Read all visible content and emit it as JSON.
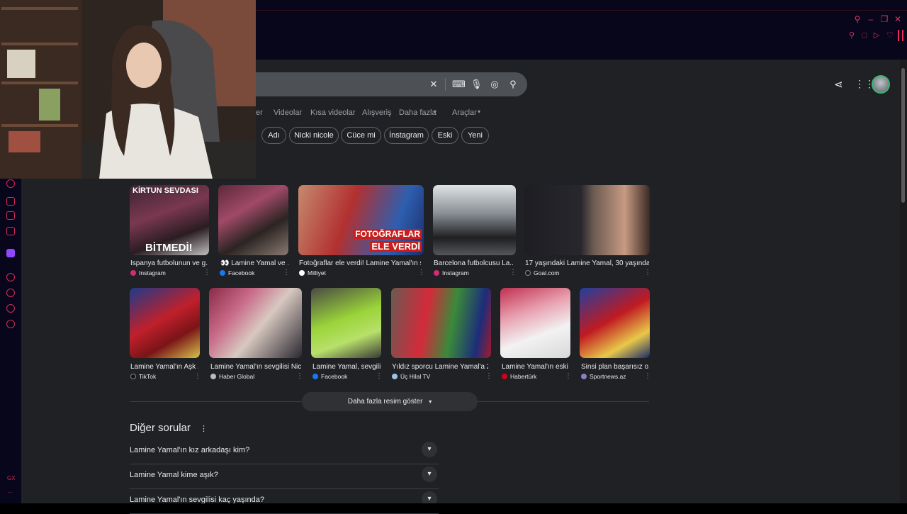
{
  "browser": {
    "sidebar_label": "GX",
    "sidebar_dots": "···"
  },
  "tabs": {
    "partial": "er",
    "items": [
      "Videolar",
      "Kısa videolar",
      "Alışveriş",
      "Daha fazla",
      "Araçlar"
    ]
  },
  "chips": [
    "Adı",
    "Nicki nicole",
    "Cüce mi",
    "İnstagram",
    "Eski",
    "Yeni"
  ],
  "images_row1": [
    {
      "caption": "İspanya futbolunun ve g...",
      "source": "Instagram",
      "source_color": "#d62976"
    },
    {
      "caption": "👀 Lamine Yamal ve ...",
      "source": "Facebook",
      "source_color": "#1877f2"
    },
    {
      "caption": "Fotoğraflar ele verdi! Lamine Yamal'ın s...",
      "source": "Milliyet",
      "source_color": "#ffffff"
    },
    {
      "caption": "Barcelona futbolcusu La...",
      "source": "Instagram",
      "source_color": "#d62976"
    },
    {
      "caption": "17 yaşındaki Lamine Yamal, 30 yaşındak...",
      "source": "Goal.com",
      "source_color": "#1a1a1a"
    }
  ],
  "images_row2": [
    {
      "caption": "Lamine Yamal'ın Aşk ...",
      "source": "TikTok",
      "source_color": "#111111"
    },
    {
      "caption": "Lamine Yamal'ın sevgilisi Nic...",
      "source": "Haber Global",
      "source_color": "#bbbbbb"
    },
    {
      "caption": "Lamine Yamal, sevgili...",
      "source": "Facebook",
      "source_color": "#1877f2"
    },
    {
      "caption": "Yıldız sporcu Lamine Yamal'a 2...",
      "source": "Üç Hilal TV",
      "source_color": "#9ec3e6"
    },
    {
      "caption": "Lamine Yamal'ın eski ...",
      "source": "Habertürk",
      "source_color": "#d0021b"
    },
    {
      "caption": "Sinsi plan başarısız o...",
      "source": "Sportnews.az",
      "source_color": "#8e7cc3"
    }
  ],
  "thumb_text": {
    "img1_top": "KİRTUN SEVDASI",
    "img1_bottom": "BİTMEDİ!",
    "img3_line1": "FOTOĞRAFLAR",
    "img3_line2": "ELE VERDİ"
  },
  "show_more_label": "Daha fazla resim göster",
  "people_also_ask": {
    "title": "Diğer sorular",
    "questions": [
      "Lamine Yamal'ın kız arkadaşı kim?",
      "Lamine Yamal kime aşık?",
      "Lamine Yamal'ın sevgilisi kaç yaşında?"
    ]
  },
  "colors": {
    "page_bg": "#202124",
    "gx_accent": "#e6305e",
    "frame_bg": "#07061a"
  }
}
